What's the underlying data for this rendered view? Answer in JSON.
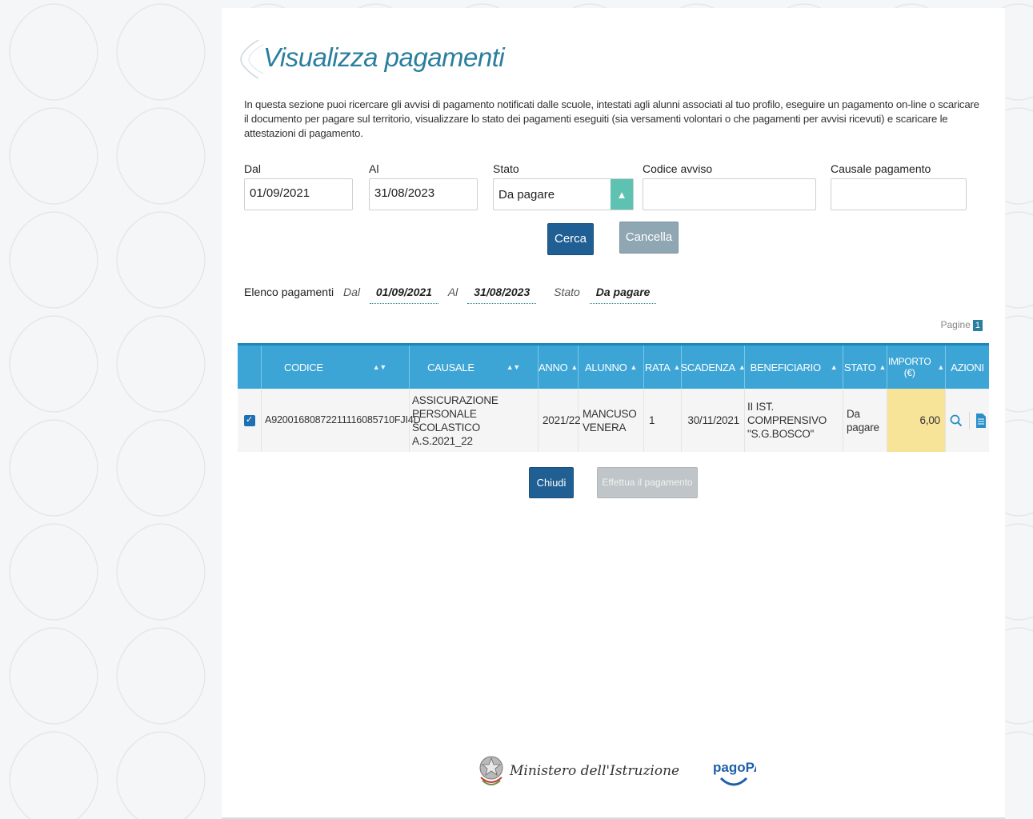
{
  "page": {
    "title": "Visualizza pagamenti",
    "intro": "In questa sezione puoi ricercare gli avvisi di pagamento notificati dalle scuole, intestati agli alunni associati al tuo profilo, eseguire un pagamento on-line o scaricare il documento per pagare sul territorio, visualizzare lo stato dei pagamenti eseguiti (sia versamenti volontari o che pagamenti per avvisi ricevuti) e scaricare le attestazioni di pagamento."
  },
  "filters": {
    "dal_label": "Dal",
    "dal_value": "01/09/2021",
    "al_label": "Al",
    "al_value": "31/08/2023",
    "stato_label": "Stato",
    "stato_value": "Da pagare",
    "codice_label": "Codice avviso",
    "codice_value": "",
    "causale_label": "Causale pagamento",
    "causale_value": ""
  },
  "buttons": {
    "cerca": "Cerca",
    "cancella": "Cancella",
    "chiudi": "Chiudi",
    "effettua": "Effettua il pagamento"
  },
  "summary": {
    "label": "Elenco pagamenti",
    "dal_label": "Dal",
    "dal_value": "01/09/2021",
    "al_label": "Al",
    "al_value": "31/08/2023",
    "stato_label": "Stato",
    "stato_value": "Da pagare"
  },
  "pagination": {
    "label": "Pagine",
    "current": "1"
  },
  "table": {
    "headers": {
      "codice": "CODICE",
      "causale": "CAUSALE",
      "anno": "ANNO",
      "alunno": "ALUNNO",
      "rata": "RATA",
      "scadenza": "SCADENZA",
      "beneficiario": "BENEFICIARIO",
      "stato": "STATO",
      "importo_1": "IMPORTO",
      "importo_2": "(€)",
      "azioni": "AZIONI"
    },
    "rows": [
      {
        "checked": true,
        "codice": "A92001680872211116085710FJI4D",
        "causale_1": "ASSICURAZIONE",
        "causale_2": "PERSONALE SCOLASTICO",
        "causale_3": "A.S.2021_22",
        "anno": "2021/22",
        "alunno_1": "MANCUSO",
        "alunno_2": "VENERA",
        "rata": "1",
        "scadenza": "30/11/2021",
        "beneficiario_1": "II IST. COMPRENSIVO",
        "beneficiario_2": "\"S.G.BOSCO\"",
        "stato_1": "Da",
        "stato_2": "pagare",
        "importo": "6,00"
      }
    ]
  },
  "footer": {
    "ministero": "Ministero dell'Istruzione",
    "pagopa": "pagoPA"
  },
  "colors": {
    "accent": "#2a7f9e",
    "header_bg": "#3da5d6",
    "primary_button": "#1f5f93",
    "importo_highlight": "#f7e499"
  }
}
